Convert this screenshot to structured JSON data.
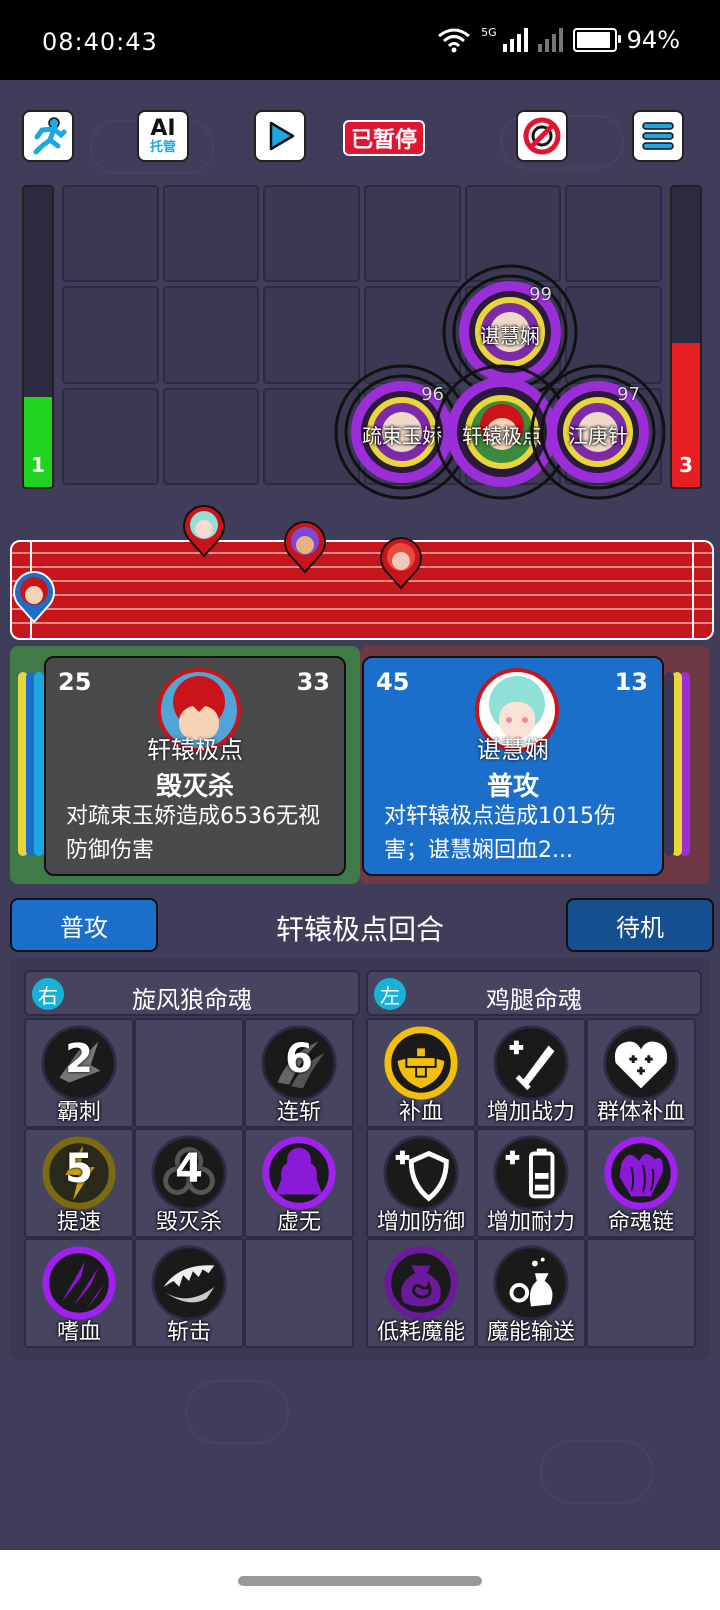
{
  "status_bar": {
    "time": "08:40:43",
    "network_label": "5G",
    "battery_text": "94%",
    "battery_level": 0.94
  },
  "toolbar": {
    "ai_label_top": "AI",
    "ai_label_bottom": "托管",
    "paused_label": "已暂停"
  },
  "gauges": {
    "left_value": "1",
    "left_color": "#21d321",
    "left_fill": 0.3,
    "right_value": "3",
    "right_color": "#e91e23",
    "right_fill": 0.48
  },
  "enemies": [
    {
      "name": "谌慧娴",
      "number": "99",
      "ring_color": "#9b2ed8"
    },
    {
      "name": "疏束玉娇",
      "number": "96",
      "ring_color": "#9b2ed8"
    },
    {
      "name": "轩辕极点",
      "number": "",
      "ring_color": "#9b2ed8"
    },
    {
      "name": "江庚针",
      "number": "97",
      "ring_color": "#9b2ed8"
    }
  ],
  "player_card": {
    "left_number": "25",
    "right_number": "33",
    "name": "轩辕极点",
    "skill": "毁灭杀",
    "description": "对疏束玉娇造成6536无视防御伤害",
    "bg_color": "#4a4a4d"
  },
  "enemy_card": {
    "left_number": "45",
    "right_number": "13",
    "name": "谌慧娴",
    "skill": "普攻",
    "description": "对轩辕极点造成1015伤害；谌慧娴回血2...",
    "bg_color": "#1b6fcb"
  },
  "actions": {
    "attack_label": "普攻",
    "standby_label": "待机",
    "turn_text": "轩辕极点回合"
  },
  "souls": {
    "left": {
      "tag": "右",
      "title": "旋风狼命魂",
      "skills": [
        {
          "label": "霸刺",
          "cooldown": "2",
          "icon": "slash-claw-icon"
        },
        {
          "label": "",
          "cooldown": "",
          "icon": "empty-slot"
        },
        {
          "label": "连斩",
          "cooldown": "6",
          "icon": "double-slash-icon"
        },
        {
          "label": "提速",
          "cooldown": "5",
          "icon": "speed-up-icon"
        },
        {
          "label": "毁灭杀",
          "cooldown": "4",
          "icon": "biohazard-icon"
        },
        {
          "label": "虚无",
          "cooldown": "",
          "icon": "void-icon"
        },
        {
          "label": "嗜血",
          "cooldown": "",
          "icon": "bloodthirst-claw-icon"
        },
        {
          "label": "斩击",
          "cooldown": "",
          "icon": "jaw-slash-icon"
        },
        {
          "label": "",
          "cooldown": "",
          "icon": "empty-slot"
        }
      ]
    },
    "right": {
      "tag": "左",
      "title": "鸡腿命魂",
      "skills": [
        {
          "label": "补血",
          "cooldown": "",
          "icon": "heal-plus-icon"
        },
        {
          "label": "增加战力",
          "cooldown": "",
          "icon": "attack-up-icon"
        },
        {
          "label": "群体补血",
          "cooldown": "",
          "icon": "group-heal-icon"
        },
        {
          "label": "增加防御",
          "cooldown": "",
          "icon": "defense-up-icon"
        },
        {
          "label": "增加耐力",
          "cooldown": "",
          "icon": "stamina-up-icon"
        },
        {
          "label": "命魂链",
          "cooldown": "",
          "icon": "soul-chain-icon"
        },
        {
          "label": "低耗魔能",
          "cooldown": "",
          "icon": "mana-bag-icon"
        },
        {
          "label": "魔能输送",
          "cooldown": "",
          "icon": "mana-transfer-icon"
        },
        {
          "label": "",
          "cooldown": "",
          "icon": "empty-slot"
        }
      ]
    }
  }
}
